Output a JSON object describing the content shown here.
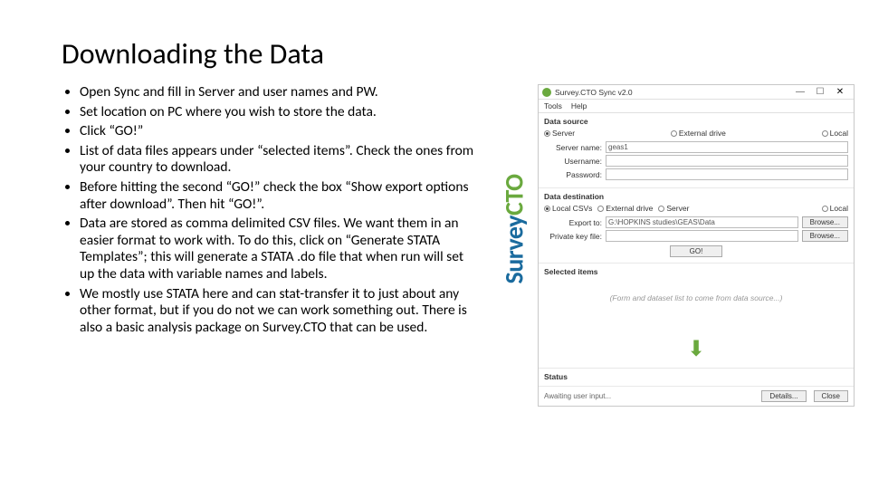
{
  "title": "Downloading the Data",
  "bullets": [
    "Open Sync and fill in Server and user names and PW.",
    "Set location on PC where you wish to store the data.",
    "Click “GO!”",
    "List of data files appears under “selected items”.  Check the ones from your country to download.",
    "Before hitting the second “GO!” check the box “Show export options after download”.  Then hit “GO!”.",
    "Data are stored as comma delimited CSV files.  We want them in an easier format to work with.  To do this, click on “Generate STATA Templates”; this will generate a STATA .do file that when run will set up the data with variable names and labels.",
    "We mostly use STATA here and can stat-transfer it to just about any other format, but if you do not we can work something out.  There is also a basic analysis package on Survey.CTO that can be used."
  ],
  "logo": {
    "part1": "Survey",
    "part2": "CTO"
  },
  "window": {
    "title": "Survey.CTO Sync v2.0",
    "menu": {
      "tools": "Tools",
      "help": "Help"
    },
    "ds": {
      "heading": "Data source",
      "opt_server": "Server",
      "opt_ext": "External drive",
      "opt_local": "Local",
      "server_label": "Server name:",
      "server_value": "geas1",
      "user_label": "Username:",
      "pass_label": "Password:"
    },
    "dd": {
      "heading": "Data destination",
      "opt_csv": "Local CSVs",
      "opt_ext": "External drive",
      "opt_server": "Server",
      "opt_local": "Local",
      "export_label": "Export to:",
      "export_value": "G:\\HOPKINS studies\\GEAS\\Data",
      "key_label": "Private key file:",
      "browse": "Browse...",
      "go": "GO!"
    },
    "selected": {
      "heading": "Selected items",
      "placeholder": "(Form and dataset list to come from data source...)"
    },
    "status": {
      "heading": "Status",
      "text": "Awaiting user input...",
      "details": "Details...",
      "close": "Close"
    }
  }
}
